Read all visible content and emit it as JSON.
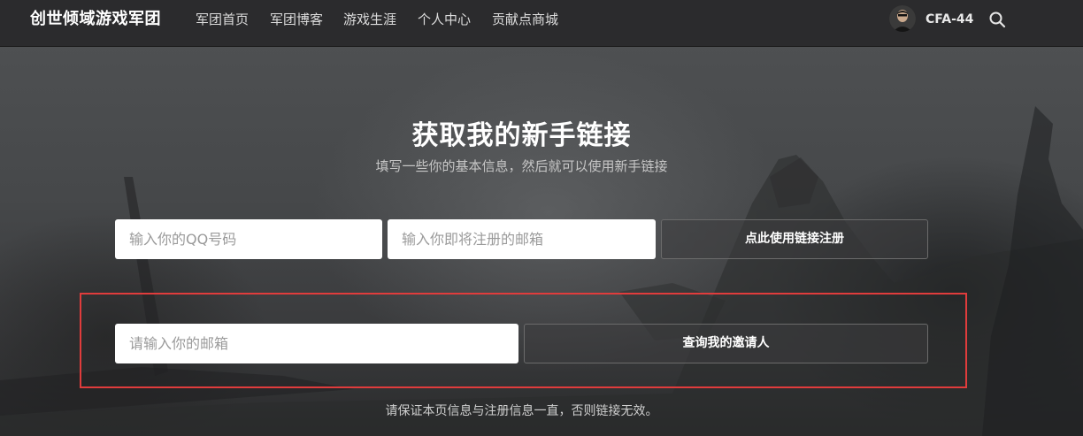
{
  "header": {
    "brand": "创世倾域游戏军团",
    "nav": [
      "军团首页",
      "军团博客",
      "游戏生涯",
      "个人中心",
      "贡献点商城"
    ],
    "username": "CFA-44",
    "search_icon": "search-icon"
  },
  "hero": {
    "title": "获取我的新手链接",
    "subtitle": "填写一些你的基本信息，然后就可以使用新手链接"
  },
  "form": {
    "qq_placeholder": "输入你的QQ号码",
    "email_placeholder": "输入你即将注册的邮箱",
    "register_button": "点此使用链接注册"
  },
  "inviter": {
    "email_placeholder": "请输入你的邮箱",
    "query_button": "查询我的邀请人"
  },
  "note": "请保证本页信息与注册信息一直，否则链接无效。",
  "colors": {
    "navbar": "#2b2b2d",
    "highlight_border": "#e03c3c"
  }
}
